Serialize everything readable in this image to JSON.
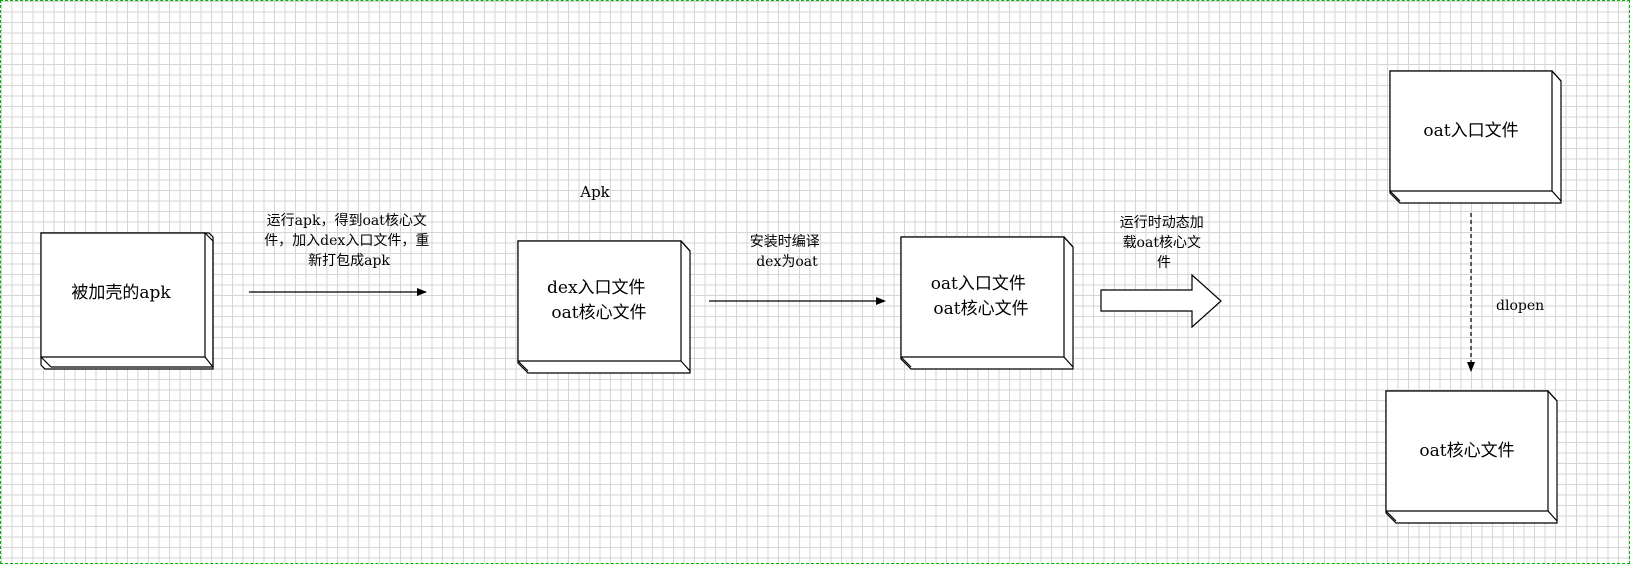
{
  "title": "Apk",
  "nodes": {
    "packed_apk": {
      "lines": [
        "被加壳的apk"
      ]
    },
    "apk_contents": {
      "lines": [
        "dex入口文件",
        "oat核心文件"
      ]
    },
    "installed": {
      "lines": [
        "oat入口文件",
        "oat核心文件"
      ]
    },
    "oat_entry": {
      "lines": [
        "oat入口文件"
      ]
    },
    "oat_core": {
      "lines": [
        "oat核心文件"
      ]
    }
  },
  "edges": {
    "run_apk": {
      "lines": [
        "运行apk，得到oat核心文",
        "件，加入dex入口文件，重",
        "新打包成apk"
      ]
    },
    "install_compile": {
      "lines": [
        "安装时编译",
        "dex为oat"
      ]
    },
    "runtime_load": {
      "lines": [
        "运行时动态加",
        "载oat核心文",
        "件"
      ]
    },
    "dlopen": {
      "lines": [
        "dlopen"
      ]
    }
  },
  "colors": {
    "border": "#00b400",
    "grid": "#d6d6d6",
    "stroke": "#000000"
  }
}
